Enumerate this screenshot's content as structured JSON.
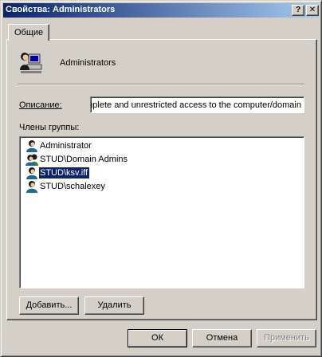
{
  "window": {
    "title": "Свойства: Administrators",
    "help_glyph": "?",
    "close_glyph": "✕"
  },
  "tabs": [
    {
      "label": "Общие",
      "active": true
    }
  ],
  "group": {
    "name": "Administrators",
    "icon": "users-group-icon"
  },
  "description": {
    "label": "Описание:",
    "value": "mplete and unrestricted access to the computer/domain"
  },
  "members": {
    "label": "Члены группы:",
    "items": [
      {
        "name": "Administrator",
        "icon": "user-icon",
        "selected": false
      },
      {
        "name": "STUD\\Domain Admins",
        "icon": "user-group-icon",
        "selected": false
      },
      {
        "name": "STUD\\ksv.iff",
        "icon": "user-icon",
        "selected": true
      },
      {
        "name": "STUD\\schalexey",
        "icon": "user-icon",
        "selected": false
      }
    ]
  },
  "buttons": {
    "add": "Добавить...",
    "remove": "Удалить",
    "ok": "ОК",
    "cancel": "Отмена",
    "apply": "Применить"
  },
  "colors": {
    "title_bar": "#0a246a",
    "selection": "#0a246a",
    "face": "#d4d0c8"
  }
}
